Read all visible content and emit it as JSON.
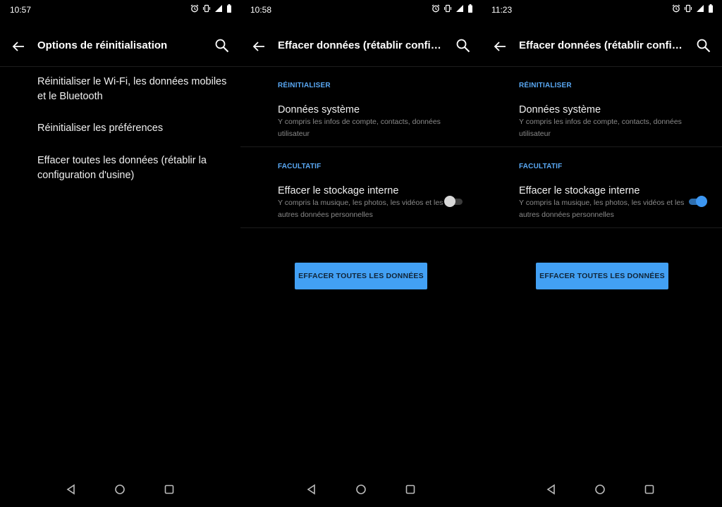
{
  "screens": [
    {
      "time": "10:57",
      "title": "Options de réinitialisation",
      "items": [
        {
          "label": "Réinitialiser le Wi-Fi, les données mobiles et le Bluetooth"
        },
        {
          "label": "Réinitialiser les préférences"
        },
        {
          "label": "Effacer toutes les données (rétablir la configuration d'usine)"
        }
      ]
    },
    {
      "time": "10:58",
      "title": "Effacer données (rétablir config. d...",
      "section1": "RÉINITIALISER",
      "system_title": "Données système",
      "system_sub": "Y compris les infos de compte, contacts, données utilisateur",
      "section2": "FACULTATIF",
      "storage_title": "Effacer le stockage interne",
      "storage_sub": "Y compris la musique, les photos, les vidéos et les autres données personnelles",
      "toggle_on": false,
      "button": "EFFACER TOUTES LES DONNÉES"
    },
    {
      "time": "11:23",
      "title": "Effacer données (rétablir config. d...",
      "section1": "RÉINITIALISER",
      "system_title": "Données système",
      "system_sub": "Y compris les infos de compte, contacts, données utilisateur",
      "section2": "FACULTATIF",
      "storage_title": "Effacer le stockage interne",
      "storage_sub": "Y compris la musique, les photos, les vidéos et les autres données personnelles",
      "toggle_on": true,
      "button": "EFFACER TOUTES LES DONNÉES"
    }
  ],
  "colors": {
    "background": "#000000",
    "accent": "#42a0f4",
    "section_label": "#5aa9f5",
    "secondary_text": "#8a8a8a"
  },
  "icons": [
    "alarm-icon",
    "vibrate-icon",
    "signal-icon",
    "battery-icon",
    "back-arrow-icon",
    "search-icon",
    "nav-back-icon",
    "nav-home-icon",
    "nav-recents-icon"
  ]
}
